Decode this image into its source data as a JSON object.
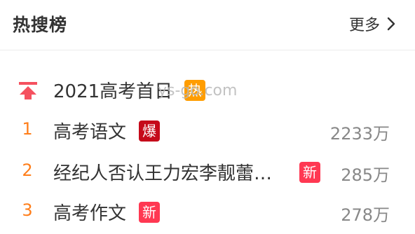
{
  "header": {
    "title": "热搜榜",
    "more_label": "更多"
  },
  "watermark": "ys-go.com",
  "pinned": {
    "title": "2021高考首日",
    "badge": "热",
    "badge_color": "#ff9d00"
  },
  "items": [
    {
      "rank": "1",
      "title": "高考语文",
      "badge": "爆",
      "badge_color": "#c50a1a",
      "count": "2233万"
    },
    {
      "rank": "2",
      "title": "经纪人否认王力宏李靓蕾…",
      "badge": "新",
      "badge_color": "#ff3852",
      "count": "285万"
    },
    {
      "rank": "3",
      "title": "高考作文",
      "badge": "新",
      "badge_color": "#ff3852",
      "count": "278万"
    }
  ],
  "colors": {
    "rank": "#ff7e1a",
    "pin_icon": "#f5515f"
  }
}
